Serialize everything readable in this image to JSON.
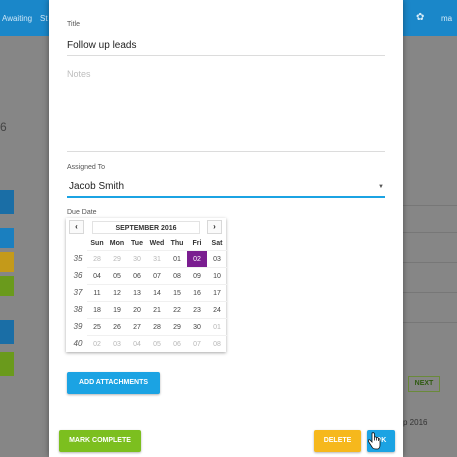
{
  "background": {
    "topbar_left_1": "Awaiting",
    "topbar_left_2": "St",
    "topbar_user": "ma",
    "side_number": "6",
    "next_label": "NEXT",
    "date_fragment": "p 2016"
  },
  "dialog": {
    "title_label": "Title",
    "title_value": "Follow up leads",
    "notes_placeholder": "Notes",
    "assigned_label": "Assigned To",
    "assigned_value": "Jacob Smith",
    "due_date_label": "Due Date",
    "buttons": {
      "add_attachments": "ADD ATTACHMENTS",
      "mark_complete": "MARK COMPLETE",
      "delete": "DELETE",
      "ok": "OK"
    }
  },
  "calendar": {
    "month_title": "SEPTEMBER 2016",
    "prev_symbol": "‹",
    "next_symbol": "›",
    "day_names": [
      "Sun",
      "Mon",
      "Tue",
      "Wed",
      "Thu",
      "Fri",
      "Sat"
    ],
    "weeks": [
      {
        "week": "35",
        "days": [
          {
            "d": "28",
            "m": true
          },
          {
            "d": "29",
            "m": true
          },
          {
            "d": "30",
            "m": true
          },
          {
            "d": "31",
            "m": true
          },
          {
            "d": "01",
            "m": false
          },
          {
            "d": "02",
            "m": false,
            "sel": true
          },
          {
            "d": "03",
            "m": false
          }
        ]
      },
      {
        "week": "36",
        "days": [
          {
            "d": "04",
            "m": false
          },
          {
            "d": "05",
            "m": false
          },
          {
            "d": "06",
            "m": false
          },
          {
            "d": "07",
            "m": false
          },
          {
            "d": "08",
            "m": false
          },
          {
            "d": "09",
            "m": false
          },
          {
            "d": "10",
            "m": false
          }
        ]
      },
      {
        "week": "37",
        "days": [
          {
            "d": "11",
            "m": false
          },
          {
            "d": "12",
            "m": false
          },
          {
            "d": "13",
            "m": false
          },
          {
            "d": "14",
            "m": false
          },
          {
            "d": "15",
            "m": false
          },
          {
            "d": "16",
            "m": false
          },
          {
            "d": "17",
            "m": false
          }
        ]
      },
      {
        "week": "38",
        "days": [
          {
            "d": "18",
            "m": false
          },
          {
            "d": "19",
            "m": false
          },
          {
            "d": "20",
            "m": false
          },
          {
            "d": "21",
            "m": false
          },
          {
            "d": "22",
            "m": false
          },
          {
            "d": "23",
            "m": false
          },
          {
            "d": "24",
            "m": false
          }
        ]
      },
      {
        "week": "39",
        "days": [
          {
            "d": "25",
            "m": false
          },
          {
            "d": "26",
            "m": false
          },
          {
            "d": "27",
            "m": false
          },
          {
            "d": "28",
            "m": false
          },
          {
            "d": "29",
            "m": false
          },
          {
            "d": "30",
            "m": false
          },
          {
            "d": "01",
            "m": true
          }
        ]
      },
      {
        "week": "40",
        "days": [
          {
            "d": "02",
            "m": true
          },
          {
            "d": "03",
            "m": true
          },
          {
            "d": "04",
            "m": true
          },
          {
            "d": "05",
            "m": true
          },
          {
            "d": "06",
            "m": true
          },
          {
            "d": "07",
            "m": true
          },
          {
            "d": "08",
            "m": true
          }
        ]
      }
    ]
  },
  "colors": {
    "topbar": "#1a87c9",
    "accent_blue": "#1ba3e3",
    "green": "#7cbf1f",
    "amber": "#f6b81c",
    "selected_day": "#7a1d90"
  },
  "icons": {
    "prev": "chevron-left-icon",
    "next": "chevron-right-icon",
    "dropdown": "caret-down-icon",
    "settings": "gear-icon",
    "pointer": "hand-cursor-icon"
  }
}
